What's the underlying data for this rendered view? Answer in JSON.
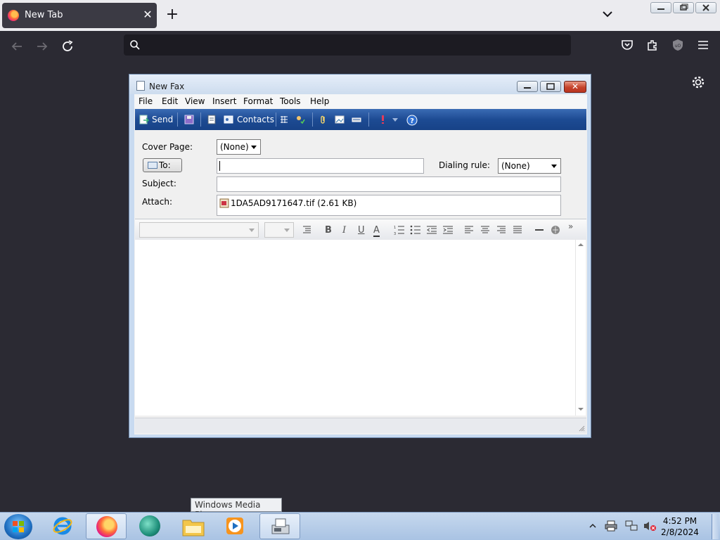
{
  "browser": {
    "tab_title": "New Tab",
    "close_glyph": "✕",
    "new_tab_glyph": "+",
    "icons": [
      "back-icon",
      "forward-icon",
      "reload-icon",
      "search-icon",
      "pocket-icon",
      "extensions-icon",
      "ublock-icon",
      "menu-icon",
      "gear-icon"
    ]
  },
  "fax": {
    "title": "New Fax",
    "menu": [
      "File",
      "Edit",
      "View",
      "Insert",
      "Format",
      "Tools",
      "Help"
    ],
    "toolbar": {
      "send_label": "Send",
      "contacts_label": "Contacts"
    },
    "form": {
      "cover_page_label": "Cover Page:",
      "cover_page_value": "(None)",
      "to_label": "To:",
      "to_value": "",
      "dialing_rule_label": "Dialing rule:",
      "dialing_rule_value": "(None)",
      "subject_label": "Subject:",
      "subject_value": "",
      "attach_label": "Attach:",
      "attachment": "1DA5AD9171647.tif (2.61 KB)"
    },
    "format_bar": {
      "bold": "B",
      "italic": "I",
      "underline": "U",
      "font_color": "A",
      "more": "»"
    }
  },
  "tooltip": "Windows Media Player",
  "taskbar": {
    "time": "4:52 PM",
    "date": "2/8/2024",
    "apps": [
      "internet-explorer-icon",
      "firefox-icon",
      "app-icon",
      "file-explorer-icon",
      "windows-media-player-icon",
      "fax-scan-icon"
    ]
  }
}
